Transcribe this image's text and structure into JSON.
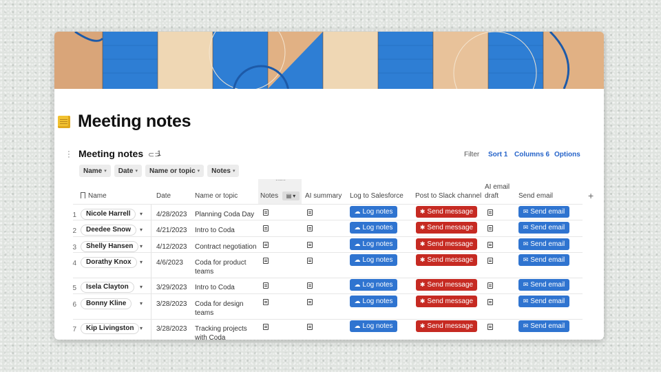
{
  "page": {
    "title": "Meeting notes"
  },
  "table": {
    "title": "Meeting notes",
    "link_count": "1",
    "toolbar": {
      "filter": "Filter",
      "sort": "Sort 1",
      "columns": "Columns 6",
      "options": "Options"
    },
    "filters": [
      "Name",
      "Date",
      "Name or topic",
      "Notes"
    ],
    "columns": {
      "name": "Name",
      "date": "Date",
      "topic": "Name or topic",
      "notes": "Notes",
      "ai_summary": "AI summary",
      "log_sf": "Log to Salesforce",
      "slack": "Post to Slack channel",
      "ai_email_1": "AI email",
      "ai_email_2": "draft",
      "send_email": "Send email"
    },
    "buttons": {
      "log": "Log notes",
      "slack": "Send message",
      "email": "Send email"
    },
    "rows": [
      {
        "num": "1",
        "name": "Nicole Harrell",
        "date": "4/28/2023",
        "topic1": "Planning Coda Day",
        "topic2": ""
      },
      {
        "num": "2",
        "name": "Deedee Snow",
        "date": "4/21/2023",
        "topic1": "Intro to Coda",
        "topic2": ""
      },
      {
        "num": "3",
        "name": "Shelly Hansen",
        "date": "4/12/2023",
        "topic1": "Contract negotiation",
        "topic2": ""
      },
      {
        "num": "4",
        "name": "Dorathy Knox",
        "date": "4/6/2023",
        "topic1": "Coda for product",
        "topic2": "teams"
      },
      {
        "num": "5",
        "name": "Isela Clayton",
        "date": "3/29/2023",
        "topic1": "Intro to Coda",
        "topic2": ""
      },
      {
        "num": "6",
        "name": "Bonny Kline",
        "date": "3/28/2023",
        "topic1": "Coda for design",
        "topic2": "teams"
      },
      {
        "num": "7",
        "name": "Kip Livingston",
        "date": "3/28/2023",
        "topic1": "Tracking projects",
        "topic2": "with Coda"
      }
    ]
  },
  "icons": {
    "page": "sticky-note-icon",
    "link": "link-icon",
    "notes": "document-icon",
    "log": "cloud-icon",
    "slack": "slack-icon",
    "email": "email-icon",
    "add": "plus-icon"
  },
  "colors": {
    "accent": "#2f74d0",
    "danger": "#c62a22",
    "link": "#2563c9"
  }
}
